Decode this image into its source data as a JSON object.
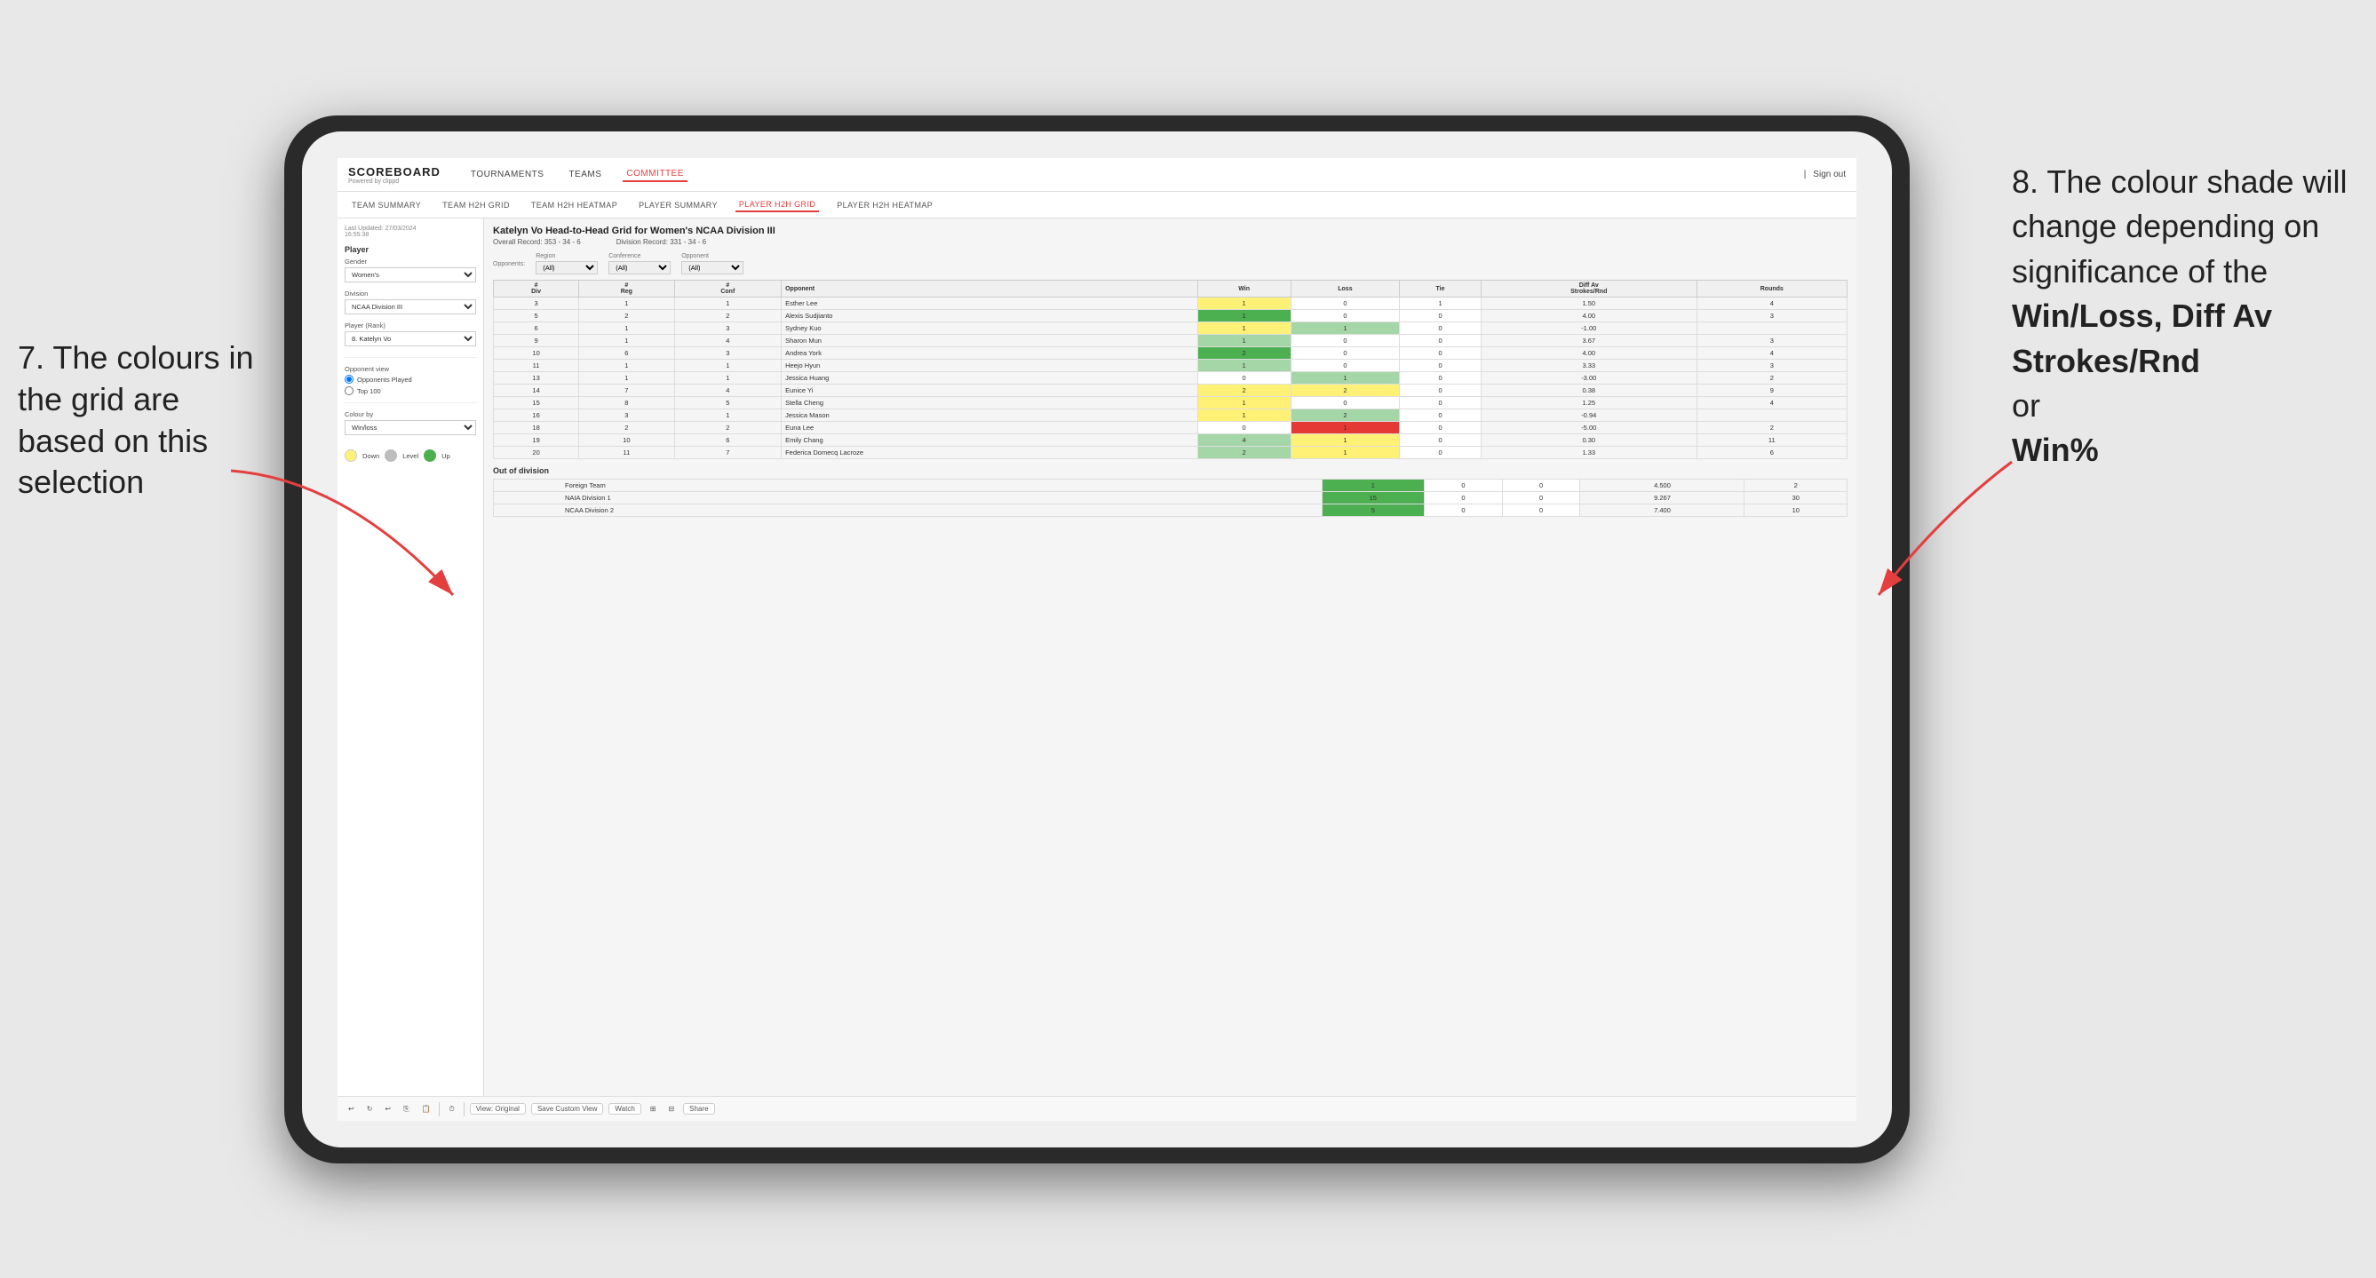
{
  "annotations": {
    "left_title": "7. The colours in the grid are based on this selection",
    "right_title": "8. The colour shade will change depending on significance of the",
    "right_bold1": "Win/Loss,",
    "right_bold2": "Diff Av Strokes/Rnd",
    "right_connector": "or",
    "right_bold3": "Win%"
  },
  "nav": {
    "logo": "SCOREBOARD",
    "logo_sub": "Powered by clippd",
    "links": [
      "TOURNAMENTS",
      "TEAMS",
      "COMMITTEE"
    ],
    "active_link": "COMMITTEE",
    "right": "Sign out"
  },
  "sub_nav": {
    "links": [
      "TEAM SUMMARY",
      "TEAM H2H GRID",
      "TEAM H2H HEATMAP",
      "PLAYER SUMMARY",
      "PLAYER H2H GRID",
      "PLAYER H2H HEATMAP"
    ],
    "active": "PLAYER H2H GRID"
  },
  "sidebar": {
    "timestamp_label": "Last Updated: 27/03/2024",
    "timestamp2": "16:55:38",
    "player_section": "Player",
    "gender_label": "Gender",
    "gender_value": "Women's",
    "division_label": "Division",
    "division_value": "NCAA Division III",
    "player_rank_label": "Player (Rank)",
    "player_rank_value": "8. Katelyn Vo",
    "opponent_view_label": "Opponent view",
    "opponents_played_label": "Opponents Played",
    "top100_label": "Top 100",
    "colour_by_label": "Colour by",
    "colour_by_value": "Win/loss",
    "legend": {
      "down_label": "Down",
      "level_label": "Level",
      "up_label": "Up"
    }
  },
  "grid": {
    "title": "Katelyn Vo Head-to-Head Grid for Women's NCAA Division III",
    "overall_record_label": "Overall Record:",
    "overall_record": "353 - 34 - 6",
    "division_record_label": "Division Record:",
    "division_record": "331 - 34 - 6",
    "filter": {
      "opponents_label": "Opponents:",
      "region_label": "Region",
      "region_value": "(All)",
      "conference_label": "Conference",
      "conference_value": "(All)",
      "opponent_label": "Opponent",
      "opponent_value": "(All)"
    },
    "col_headers": [
      "#\nDiv",
      "#\nReg",
      "#\nConf",
      "Opponent",
      "Win",
      "Loss",
      "Tie",
      "Diff Av\nStrokes/Rnd",
      "Rounds"
    ],
    "rows": [
      {
        "div": 3,
        "reg": 1,
        "conf": 1,
        "opponent": "Esther Lee",
        "win": 1,
        "loss": 0,
        "tie": 1,
        "diff": "1.50",
        "rounds": 4,
        "win_color": "yellow",
        "loss_color": "white",
        "tie_color": "white"
      },
      {
        "div": 5,
        "reg": 2,
        "conf": 2,
        "opponent": "Alexis Sudjianto",
        "win": 1,
        "loss": 0,
        "tie": 0,
        "diff": "4.00",
        "rounds": 3,
        "win_color": "green_dark",
        "loss_color": "white",
        "tie_color": "white"
      },
      {
        "div": 6,
        "reg": 1,
        "conf": 3,
        "opponent": "Sydney Kuo",
        "win": 1,
        "loss": 1,
        "tie": 0,
        "diff": "-1.00",
        "rounds": "",
        "win_color": "yellow",
        "loss_color": "green_light",
        "tie_color": "white"
      },
      {
        "div": 9,
        "reg": 1,
        "conf": 4,
        "opponent": "Sharon Mun",
        "win": 1,
        "loss": 0,
        "tie": 0,
        "diff": "3.67",
        "rounds": 3,
        "win_color": "green_light",
        "loss_color": "white",
        "tie_color": "white"
      },
      {
        "div": 10,
        "reg": 6,
        "conf": 3,
        "opponent": "Andrea York",
        "win": 2,
        "loss": 0,
        "tie": 0,
        "diff": "4.00",
        "rounds": 4,
        "win_color": "green_dark",
        "loss_color": "white",
        "tie_color": "white"
      },
      {
        "div": 11,
        "reg": 1,
        "conf": 1,
        "opponent": "Heejo Hyun",
        "win": 1,
        "loss": 0,
        "tie": 0,
        "diff": "3.33",
        "rounds": 3,
        "win_color": "green_light",
        "loss_color": "white",
        "tie_color": "white"
      },
      {
        "div": 13,
        "reg": 1,
        "conf": 1,
        "opponent": "Jessica Huang",
        "win": 0,
        "loss": 1,
        "tie": 0,
        "diff": "-3.00",
        "rounds": 2,
        "win_color": "white",
        "loss_color": "green_light",
        "tie_color": "white"
      },
      {
        "div": 14,
        "reg": 7,
        "conf": 4,
        "opponent": "Eunice Yi",
        "win": 2,
        "loss": 2,
        "tie": 0,
        "diff": "0.38",
        "rounds": 9,
        "win_color": "yellow",
        "loss_color": "yellow",
        "tie_color": "white"
      },
      {
        "div": 15,
        "reg": 8,
        "conf": 5,
        "opponent": "Stella Cheng",
        "win": 1,
        "loss": 0,
        "tie": 0,
        "diff": "1.25",
        "rounds": 4,
        "win_color": "yellow",
        "loss_color": "white",
        "tie_color": "white"
      },
      {
        "div": 16,
        "reg": 3,
        "conf": 1,
        "opponent": "Jessica Mason",
        "win": 1,
        "loss": 2,
        "tie": 0,
        "diff": "-0.94",
        "rounds": "",
        "win_color": "yellow",
        "loss_color": "green_light",
        "tie_color": "white"
      },
      {
        "div": 18,
        "reg": 2,
        "conf": 2,
        "opponent": "Euna Lee",
        "win": 0,
        "loss": 1,
        "tie": 0,
        "diff": "-5.00",
        "rounds": 2,
        "win_color": "white",
        "loss_color": "red_dark",
        "tie_color": "white"
      },
      {
        "div": 19,
        "reg": 10,
        "conf": 6,
        "opponent": "Emily Chang",
        "win": 4,
        "loss": 1,
        "tie": 0,
        "diff": "0.30",
        "rounds": 11,
        "win_color": "green_light",
        "loss_color": "yellow",
        "tie_color": "white"
      },
      {
        "div": 20,
        "reg": 11,
        "conf": 7,
        "opponent": "Federica Domecq Lacroze",
        "win": 2,
        "loss": 1,
        "tie": 0,
        "diff": "1.33",
        "rounds": 6,
        "win_color": "green_light",
        "loss_color": "yellow",
        "tie_color": "white"
      }
    ],
    "out_of_division_title": "Out of division",
    "out_of_division_rows": [
      {
        "opponent": "Foreign Team",
        "win": 1,
        "loss": 0,
        "tie": 0,
        "diff": "4.500",
        "rounds": 2,
        "win_color": "green_dark",
        "loss_color": "white"
      },
      {
        "opponent": "NAIA Division 1",
        "win": 15,
        "loss": 0,
        "tie": 0,
        "diff": "9.267",
        "rounds": 30,
        "win_color": "green_dark",
        "loss_color": "white"
      },
      {
        "opponent": "NCAA Division 2",
        "win": 5,
        "loss": 0,
        "tie": 0,
        "diff": "7.400",
        "rounds": 10,
        "win_color": "green_dark",
        "loss_color": "white"
      }
    ]
  },
  "toolbar": {
    "view_original": "View: Original",
    "save_custom": "Save Custom View",
    "watch": "Watch",
    "share": "Share"
  }
}
